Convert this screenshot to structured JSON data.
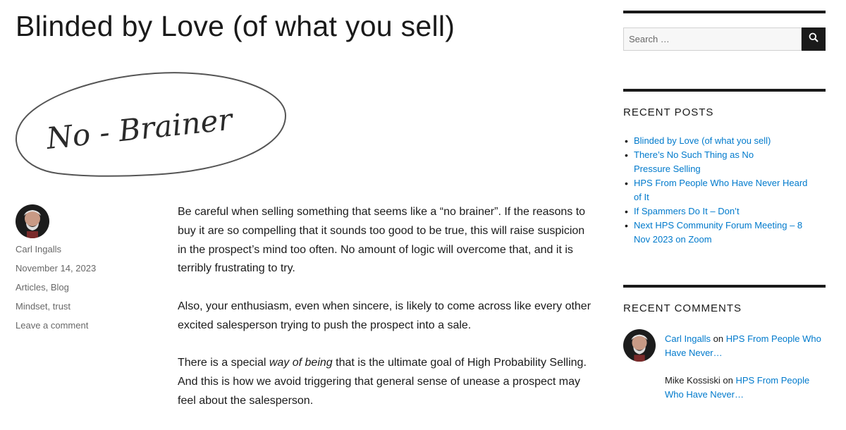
{
  "post": {
    "title": "Blinded by Love (of what you sell)",
    "image_text": "No - Brainer",
    "author": "Carl Ingalls",
    "date": "November 14, 2023",
    "categories": [
      "Articles",
      "Blog"
    ],
    "tags": [
      "Mindset",
      "trust"
    ],
    "comment_link": "Leave a comment",
    "paragraph1": "Be careful when selling something that seems like a “no brainer”. If the reasons to buy it are so compelling that it sounds too good to be true, this will raise suspicion in the prospect’s mind too often. No amount of logic will overcome that, and it is terribly frustrating to try.",
    "paragraph2": "Also, your enthusiasm, even when sincere, is likely to come across like every other excited salesperson trying to push the prospect into a sale.",
    "paragraph3_before": "There is a special ",
    "paragraph3_em": "way of being",
    "paragraph3_after": " that is the ultimate goal of High Probability Selling. And this is how we avoid triggering that general sense of unease a prospect may feel about the salesperson."
  },
  "sidebar": {
    "search": {
      "placeholder": "Search …",
      "icon": "search-icon"
    },
    "recent_posts": {
      "title": "RECENT POSTS",
      "items": [
        "Blinded by Love (of what you sell)",
        "There’s No Such Thing as No Pressure Selling",
        "HPS From People Who Have Never Heard of It",
        "If Spammers Do It – Don’t",
        "Next HPS Community Forum Meeting – 8 Nov 2023 on Zoom"
      ]
    },
    "recent_comments": {
      "title": "RECENT COMMENTS",
      "items": [
        {
          "author": "Carl Ingalls",
          "on": "on",
          "post": "HPS From People Who Have Never…"
        },
        {
          "author": "Mike Kossiski",
          "on": "on",
          "post": "HPS From People Who Have Never…"
        }
      ]
    }
  },
  "colors": {
    "link": "#007acc",
    "text": "#1a1a1a",
    "meta": "#686868",
    "rule": "#1a1a1a"
  }
}
